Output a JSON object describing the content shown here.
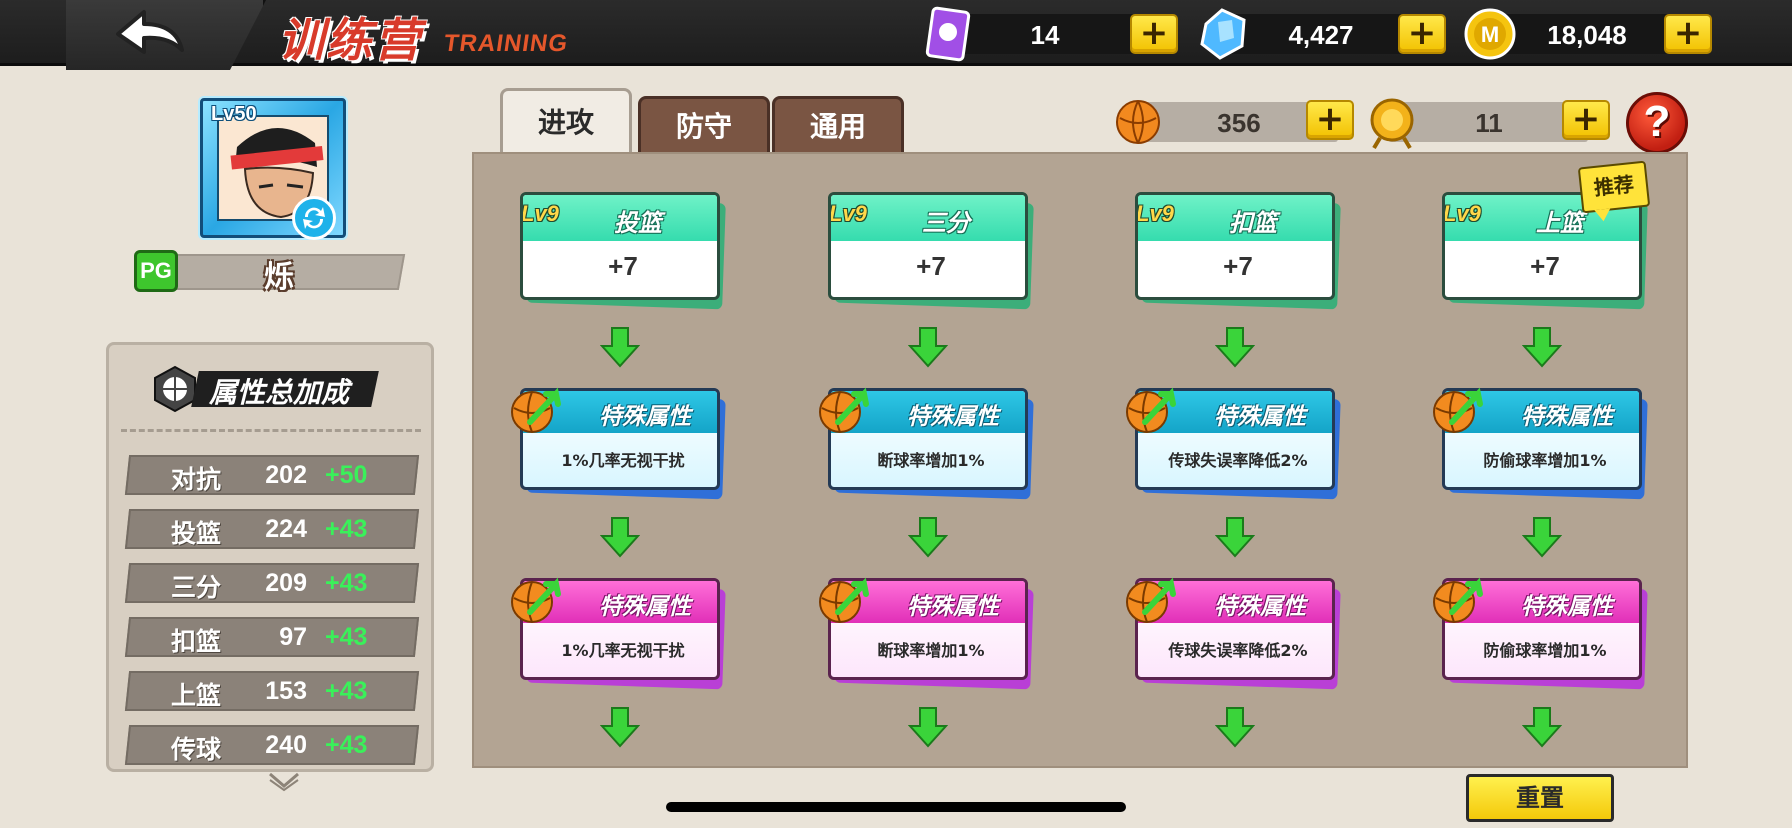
{
  "header": {
    "title_cn": "训练营",
    "title_en": "TRAINING",
    "currencies": [
      {
        "icon": "purple-card-icon",
        "value": "14"
      },
      {
        "icon": "diamond-icon",
        "value": "4,427"
      },
      {
        "icon": "gold-coin-icon",
        "value": "18,048"
      }
    ]
  },
  "player": {
    "level": "Lv50",
    "position": "PG",
    "name": "烁"
  },
  "stats_panel": {
    "title": "属性总加成",
    "rows": [
      {
        "label": "对抗",
        "value": "202",
        "bonus": "+50"
      },
      {
        "label": "投篮",
        "value": "224",
        "bonus": "+43"
      },
      {
        "label": "三分",
        "value": "209",
        "bonus": "+43"
      },
      {
        "label": "扣篮",
        "value": "97",
        "bonus": "+43"
      },
      {
        "label": "上篮",
        "value": "153",
        "bonus": "+43"
      },
      {
        "label": "传球",
        "value": "240",
        "bonus": "+43"
      }
    ]
  },
  "tabs": [
    {
      "label": "进攻",
      "active": true
    },
    {
      "label": "防守",
      "active": false
    },
    {
      "label": "通用",
      "active": false
    }
  ],
  "sub_currencies": [
    {
      "icon": "orange-ball-icon",
      "value": "356"
    },
    {
      "icon": "gold-medal-icon",
      "value": "11"
    }
  ],
  "columns": [
    {
      "level": "Lv9",
      "name": "投篮",
      "amount": "+7",
      "recommended": false,
      "special1": {
        "title": "特殊属性",
        "desc": "1%几率无视干扰"
      },
      "special2": {
        "title": "特殊属性",
        "desc": "1%几率无视干扰"
      }
    },
    {
      "level": "Lv9",
      "name": "三分",
      "amount": "+7",
      "recommended": false,
      "special1": {
        "title": "特殊属性",
        "desc": "断球率增加1%"
      },
      "special2": {
        "title": "特殊属性",
        "desc": "断球率增加1%"
      }
    },
    {
      "level": "Lv9",
      "name": "扣篮",
      "amount": "+7",
      "recommended": false,
      "special1": {
        "title": "特殊属性",
        "desc": "传球失误率降低2%"
      },
      "special2": {
        "title": "特殊属性",
        "desc": "传球失误率降低2%"
      }
    },
    {
      "level": "Lv9",
      "name": "上篮",
      "amount": "+7",
      "recommended": true,
      "special1": {
        "title": "特殊属性",
        "desc": "防偷球率增加1%"
      },
      "special2": {
        "title": "特殊属性",
        "desc": "防偷球率增加1%"
      }
    }
  ],
  "recommend_label": "推荐",
  "reset_label": "重置",
  "colors": {
    "accent_yellow": "#f2c100",
    "green_bonus": "#3af05a",
    "teal_card": "#35dcae",
    "blue_card": "#14a4c8",
    "pink_card": "#e12fb8"
  }
}
